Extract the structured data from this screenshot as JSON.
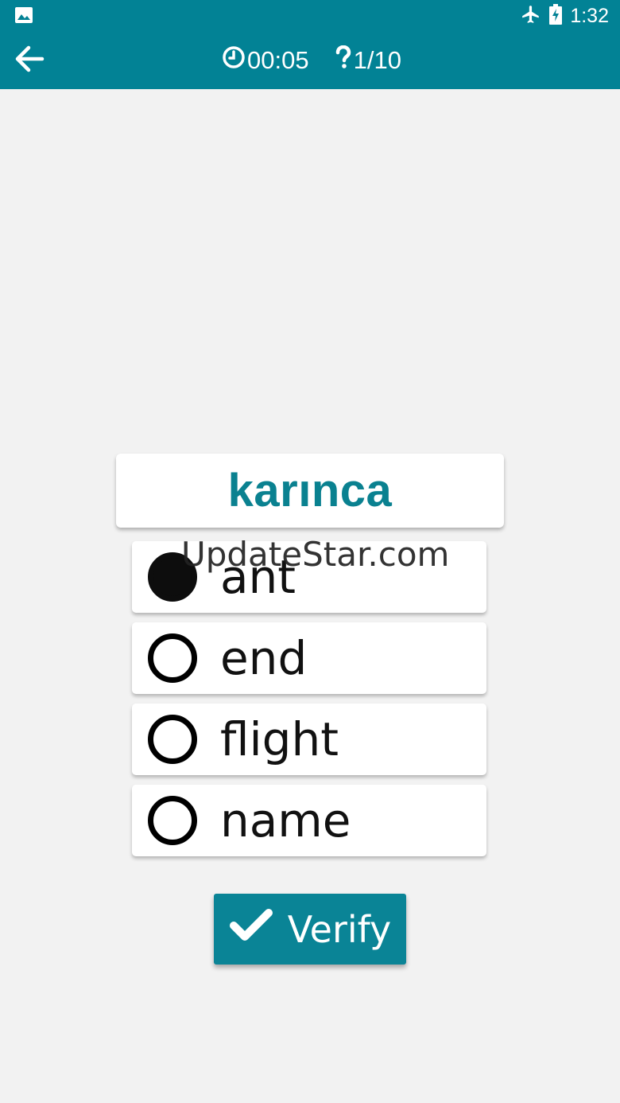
{
  "status_bar": {
    "time": "1:32",
    "icons": [
      "image-icon",
      "airplane-icon",
      "battery-charging-icon"
    ]
  },
  "app_bar": {
    "back_icon": "arrow-left-icon",
    "timer_icon": "clock-icon",
    "timer": "00:05",
    "progress_icon": "question-icon",
    "progress": "1/10"
  },
  "question": {
    "word": "karınca"
  },
  "options": [
    {
      "label": "ant",
      "selected": true
    },
    {
      "label": "end",
      "selected": false
    },
    {
      "label": "flight",
      "selected": false
    },
    {
      "label": "name",
      "selected": false
    }
  ],
  "watermark": "UpdateStar.com",
  "verify": {
    "icon": "checkmark-icon",
    "label": "Verify"
  },
  "colors": {
    "primary": "#028295",
    "accent_text": "#0a8190",
    "background": "#f2f2f2"
  }
}
